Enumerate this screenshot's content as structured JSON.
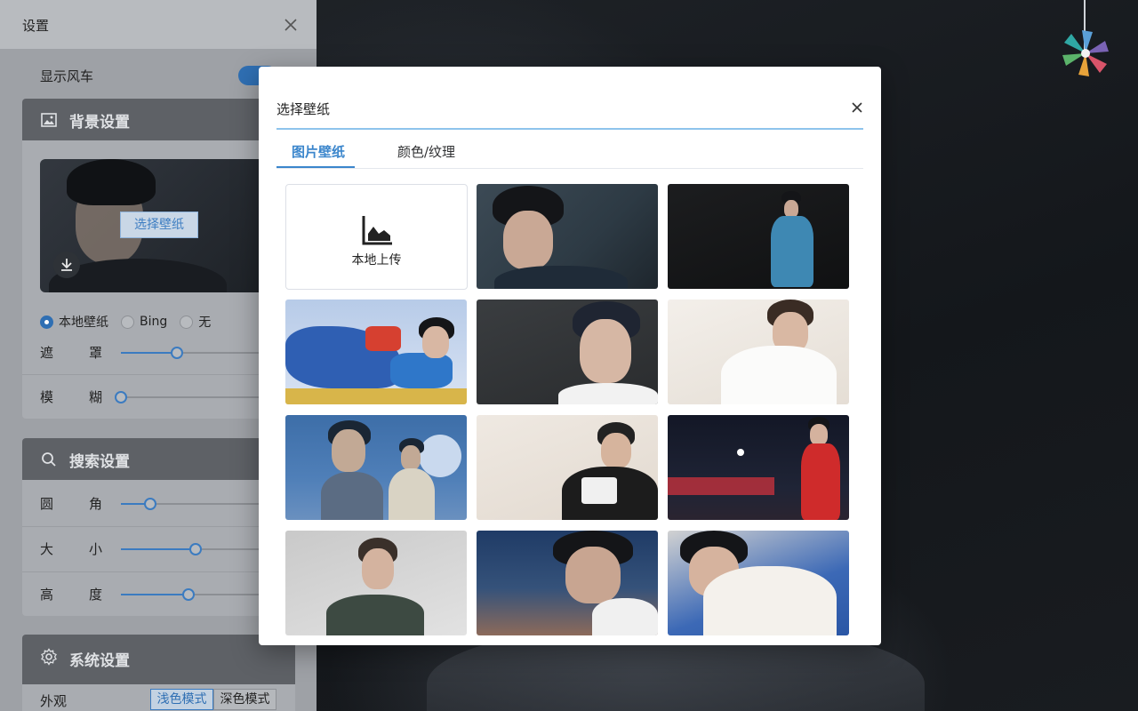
{
  "settings": {
    "title": "设置",
    "show_windmill_label": "显示风车",
    "show_windmill_on": true,
    "background": {
      "heading": "背景设置",
      "choose_button": "选择壁纸",
      "source_options": [
        "本地壁纸",
        "Bing",
        "无"
      ],
      "selected_source": "本地壁纸",
      "mask": {
        "label_a": "遮",
        "label_b": "罩",
        "value": 0.32
      },
      "blur": {
        "label_a": "模",
        "label_b": "糊",
        "value": 0.0
      }
    },
    "search": {
      "heading": "搜索设置",
      "radius": {
        "label_a": "圆",
        "label_b": "角",
        "value": 0.17
      },
      "size": {
        "label_a": "大",
        "label_b": "小",
        "value": 0.43
      },
      "height": {
        "label_a": "高",
        "label_b": "度",
        "value": 0.39
      }
    },
    "system": {
      "heading": "系统设置",
      "appearance_label": "外观",
      "modes": [
        "浅色模式",
        "深色模式"
      ],
      "selected_mode": "浅色模式"
    }
  },
  "dialog": {
    "title": "选择壁纸",
    "tabs": [
      "图片壁纸",
      "颜色/纹理"
    ],
    "active_tab": "图片壁纸",
    "upload_label": "本地上传",
    "wallpaper_count": 11
  },
  "colors": {
    "accent": "#3b86cc",
    "panel": "#9ea1a6",
    "dialog_bg": "#ffffff"
  }
}
